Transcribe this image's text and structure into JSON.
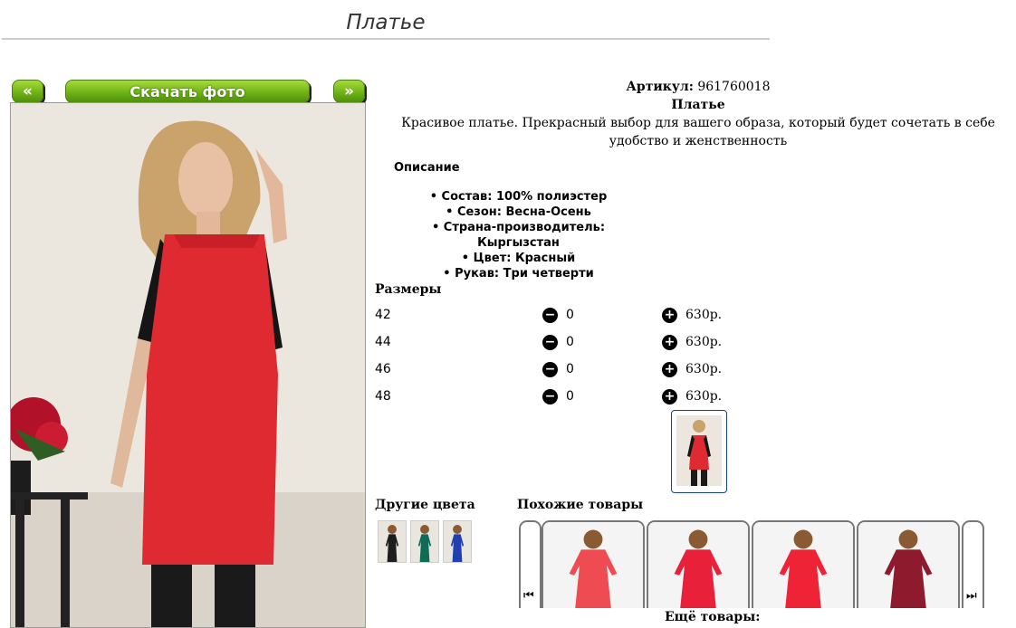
{
  "page": {
    "title": "Платье"
  },
  "gallery": {
    "prev_label": "«",
    "download_label": "Скачать фото",
    "next_label": "»"
  },
  "product": {
    "article_label": "Артикул:",
    "article_value": "961760018",
    "name": "Платье",
    "tagline": "Красивое платье. Прекрасный выбор для вашего образа, который будет сочетать в себе удобство и женственность",
    "description_title": "Описание",
    "properties": [
      "Состав: 100% полиэстер",
      "Сезон: Весна-Осень",
      "Страна-производитель: Кыргызстан",
      "Цвет: Красный",
      "Рукав: Три четверти"
    ]
  },
  "sizes": {
    "title": "Размеры",
    "minus_icon": "−",
    "plus_icon": "+",
    "rows": [
      {
        "size": "42",
        "qty": "0",
        "price": "630р."
      },
      {
        "size": "44",
        "qty": "0",
        "price": "630р."
      },
      {
        "size": "46",
        "qty": "0",
        "price": "630р."
      },
      {
        "size": "48",
        "qty": "0",
        "price": "630р."
      }
    ]
  },
  "other_colors": {
    "title": "Другие цвета",
    "colors": [
      "#1d1d1d",
      "#0f6b55",
      "#1f3fb3"
    ]
  },
  "similar": {
    "title": "Похожие товары",
    "prev_icon": "⏮",
    "next_icon": "⏭",
    "item_colors": [
      "#ef4b52",
      "#e8203a",
      "#ee2436",
      "#8e1a2e"
    ]
  },
  "more_label": "Ещё товары:",
  "colors": {
    "accent_green": "#6fb317",
    "dress_red": "#e02a32"
  }
}
